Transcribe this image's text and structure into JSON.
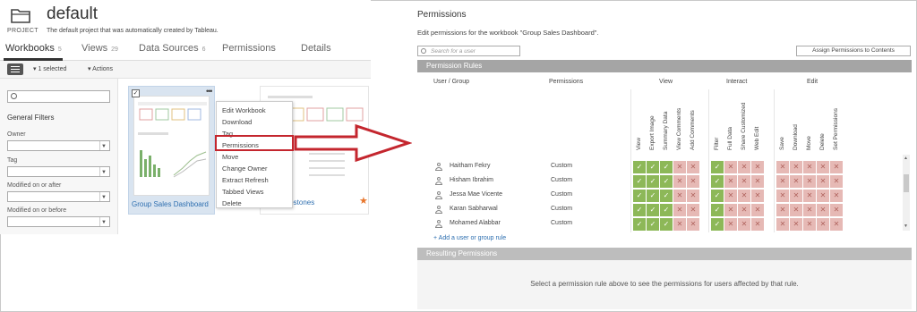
{
  "project": {
    "name": "default",
    "label": "PROJECT",
    "description": "The default project that was automatically created by Tableau."
  },
  "tabs": [
    {
      "label": "Workbooks",
      "count": "5"
    },
    {
      "label": "Views",
      "count": "29"
    },
    {
      "label": "Data Sources",
      "count": "6"
    },
    {
      "label": "Permissions",
      "count": ""
    },
    {
      "label": "Details",
      "count": ""
    }
  ],
  "toolbar": {
    "selected": "1 selected",
    "actions": "Actions"
  },
  "filters": {
    "title": "General Filters",
    "owner": "Owner",
    "tag": "Tag",
    "modified_after": "Modified on or after",
    "modified_before": "Modified on or before"
  },
  "cards": {
    "card1_title": "Group Sales Dashboard",
    "card2_title": "Milestones"
  },
  "context_menu": [
    "Edit Workbook",
    "Download",
    "Tag",
    "Permissions",
    "Move",
    "Change Owner",
    "Extract Refresh",
    "Tabbed Views",
    "Delete"
  ],
  "permissions": {
    "title": "Permissions",
    "description": "Edit permissions for the workbook \"Group Sales Dashboard\".",
    "search_placeholder": "Search for a user",
    "assign_button": "Assign Permissions to Contents",
    "rules_header": "Permission Rules",
    "col_user": "User / Group",
    "col_perms": "Permissions",
    "group_view": "View",
    "group_interact": "Interact",
    "group_edit": "Edit",
    "capabilities": [
      "View",
      "Export Image",
      "Summary Data",
      "View Comments",
      "Add Comments",
      "Filter",
      "Full Data",
      "Share Customized",
      "Web Edit",
      "Save",
      "Download",
      "Move",
      "Delete",
      "Set Permissions"
    ],
    "rows": [
      {
        "name": "Haitham Fekry",
        "perm": "Custom",
        "cells": [
          "a",
          "a",
          "a",
          "d",
          "d",
          "a",
          "d",
          "d",
          "d",
          "d",
          "d",
          "d",
          "d",
          "d"
        ]
      },
      {
        "name": "Hisham Ibrahim",
        "perm": "Custom",
        "cells": [
          "a",
          "a",
          "a",
          "d",
          "d",
          "a",
          "d",
          "d",
          "d",
          "d",
          "d",
          "d",
          "d",
          "d"
        ]
      },
      {
        "name": "Jessa Mae Vicente",
        "perm": "Custom",
        "cells": [
          "a",
          "a",
          "a",
          "d",
          "d",
          "a",
          "d",
          "d",
          "d",
          "d",
          "d",
          "d",
          "d",
          "d"
        ]
      },
      {
        "name": "Karan Sabharwal",
        "perm": "Custom",
        "cells": [
          "a",
          "a",
          "a",
          "d",
          "d",
          "a",
          "d",
          "d",
          "d",
          "d",
          "d",
          "d",
          "d",
          "d"
        ]
      },
      {
        "name": "Mohamed Alabbar",
        "perm": "Custom",
        "cells": [
          "a",
          "a",
          "a",
          "d",
          "d",
          "a",
          "d",
          "d",
          "d",
          "d",
          "d",
          "d",
          "d",
          "d"
        ]
      }
    ],
    "add_rule": "+ Add a user or group rule",
    "resulting_header": "Resulting Permissions",
    "resulting_message": "Select a permission rule above to see the permissions for users affected by that rule."
  },
  "colors": {
    "allow": "#8db858",
    "deny": "#e6b9b5",
    "highlight": "#c4262e",
    "link": "#2e6fb0"
  }
}
